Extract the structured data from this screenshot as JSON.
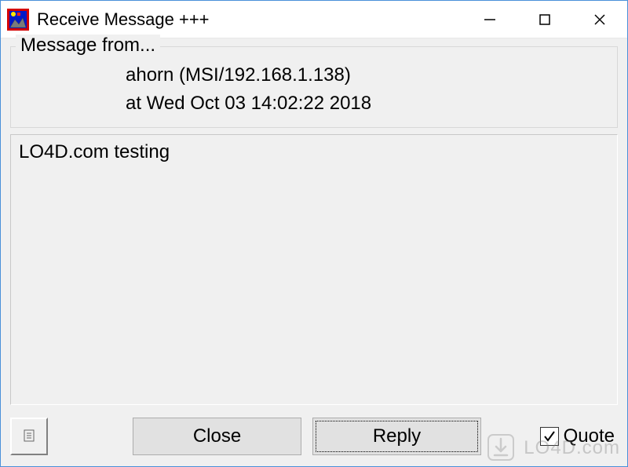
{
  "window": {
    "title": "Receive Message +++",
    "icon_name": "app-icon"
  },
  "header": {
    "legend": "Message from...",
    "sender": "ahorn (MSI/192.168.1.138)",
    "timestamp": "at Wed Oct 03 14:02:22 2018"
  },
  "message": {
    "body": "LO4D.com testing"
  },
  "buttons": {
    "close_label": "Close",
    "reply_label": "Reply"
  },
  "quote": {
    "label": "Quote",
    "checked": true
  },
  "watermark": "LO4D.com"
}
